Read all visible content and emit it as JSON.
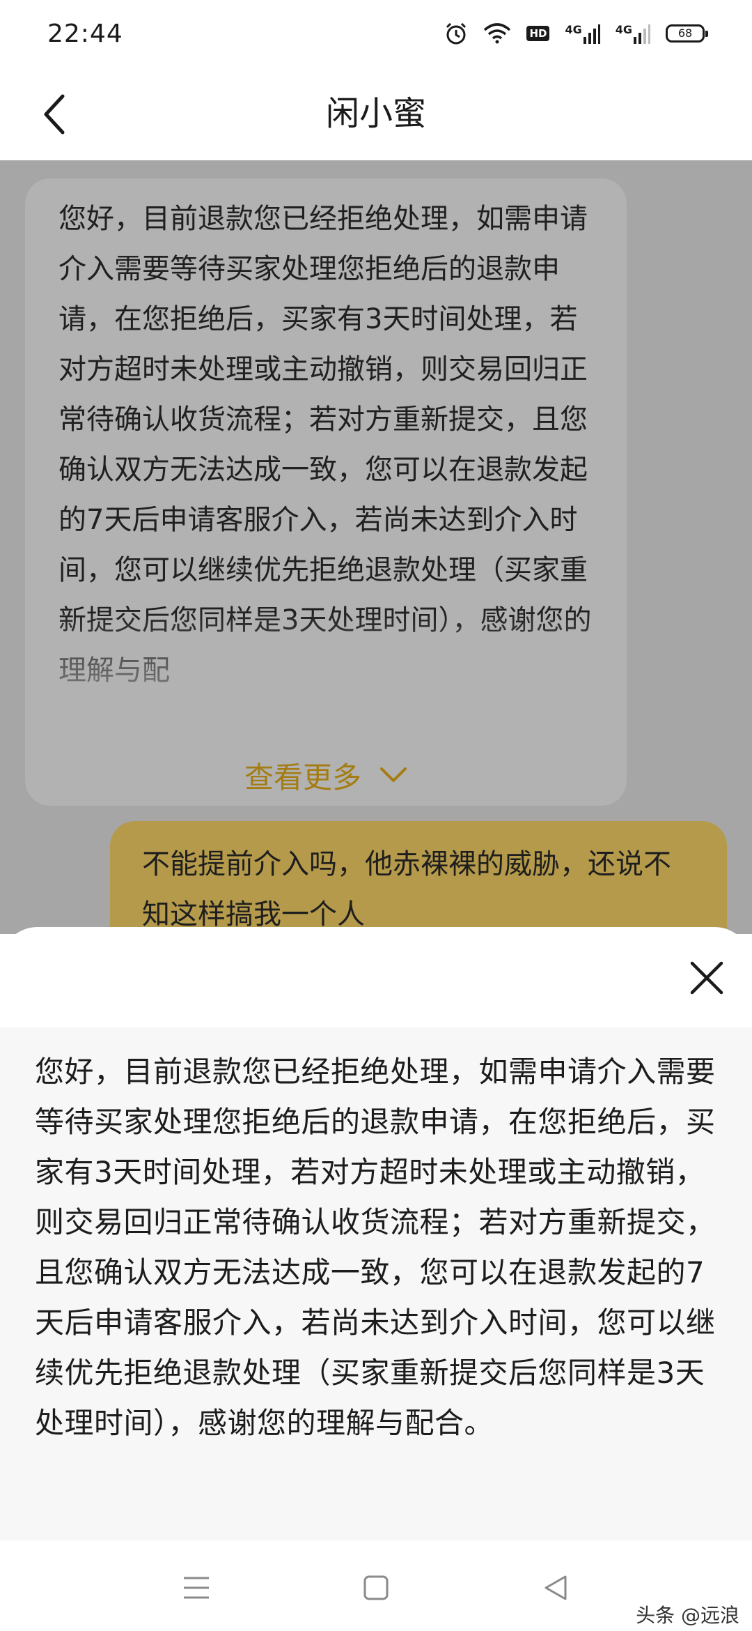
{
  "status_bar": {
    "time": "22:44",
    "icons": [
      "alarm-icon",
      "wifi-icon",
      "hd-badge",
      "signal-icon",
      "signal-icon",
      "battery-icon"
    ],
    "hd_label": "HD",
    "network_1": "4G",
    "network_2": "4G",
    "battery": "68"
  },
  "header": {
    "title": "闲小蜜",
    "back_icon": "chevron-left-icon"
  },
  "chat": {
    "incoming_message": "您好，目前退款您已经拒绝处理，如需申请介入需要等待买家处理您拒绝后的退款申请，在您拒绝后，买家有3天时间处理，若对方超时未处理或主动撤销，则交易回归正常待确认收货流程；若对方重新提交，且您确认双方无法达成一致，您可以在退款发起的7天后申请客服介入，若尚未达到介入时间，您可以继续优先拒绝退款处理（买家重新提交后您同样是3天处理时间），感谢您的理解与配",
    "see_more_label": "查看更多",
    "outgoing_message": "不能提前介入吗，他赤裸裸的威胁，还说不知这样搞我一个人",
    "colors": {
      "accent": "#a47c12",
      "outgoing_bubble": "#b49a4a"
    }
  },
  "sheet": {
    "close_icon": "close-icon",
    "full_message": "您好，目前退款您已经拒绝处理，如需申请介入需要等待买家处理您拒绝后的退款申请，在您拒绝后，买家有3天时间处理，若对方超时未处理或主动撤销，则交易回归正常待确认收货流程；若对方重新提交，且您确认双方无法达成一致，您可以在退款发起的7天后申请客服介入，若尚未达到介入时间，您可以继续优先拒绝退款处理（买家重新提交后您同样是3天处理时间），感谢您的理解与配合。"
  },
  "nav_bar": {
    "icons": [
      "menu-icon",
      "home-square-icon",
      "back-triangle-icon"
    ]
  },
  "watermark": "头条 @远浪"
}
